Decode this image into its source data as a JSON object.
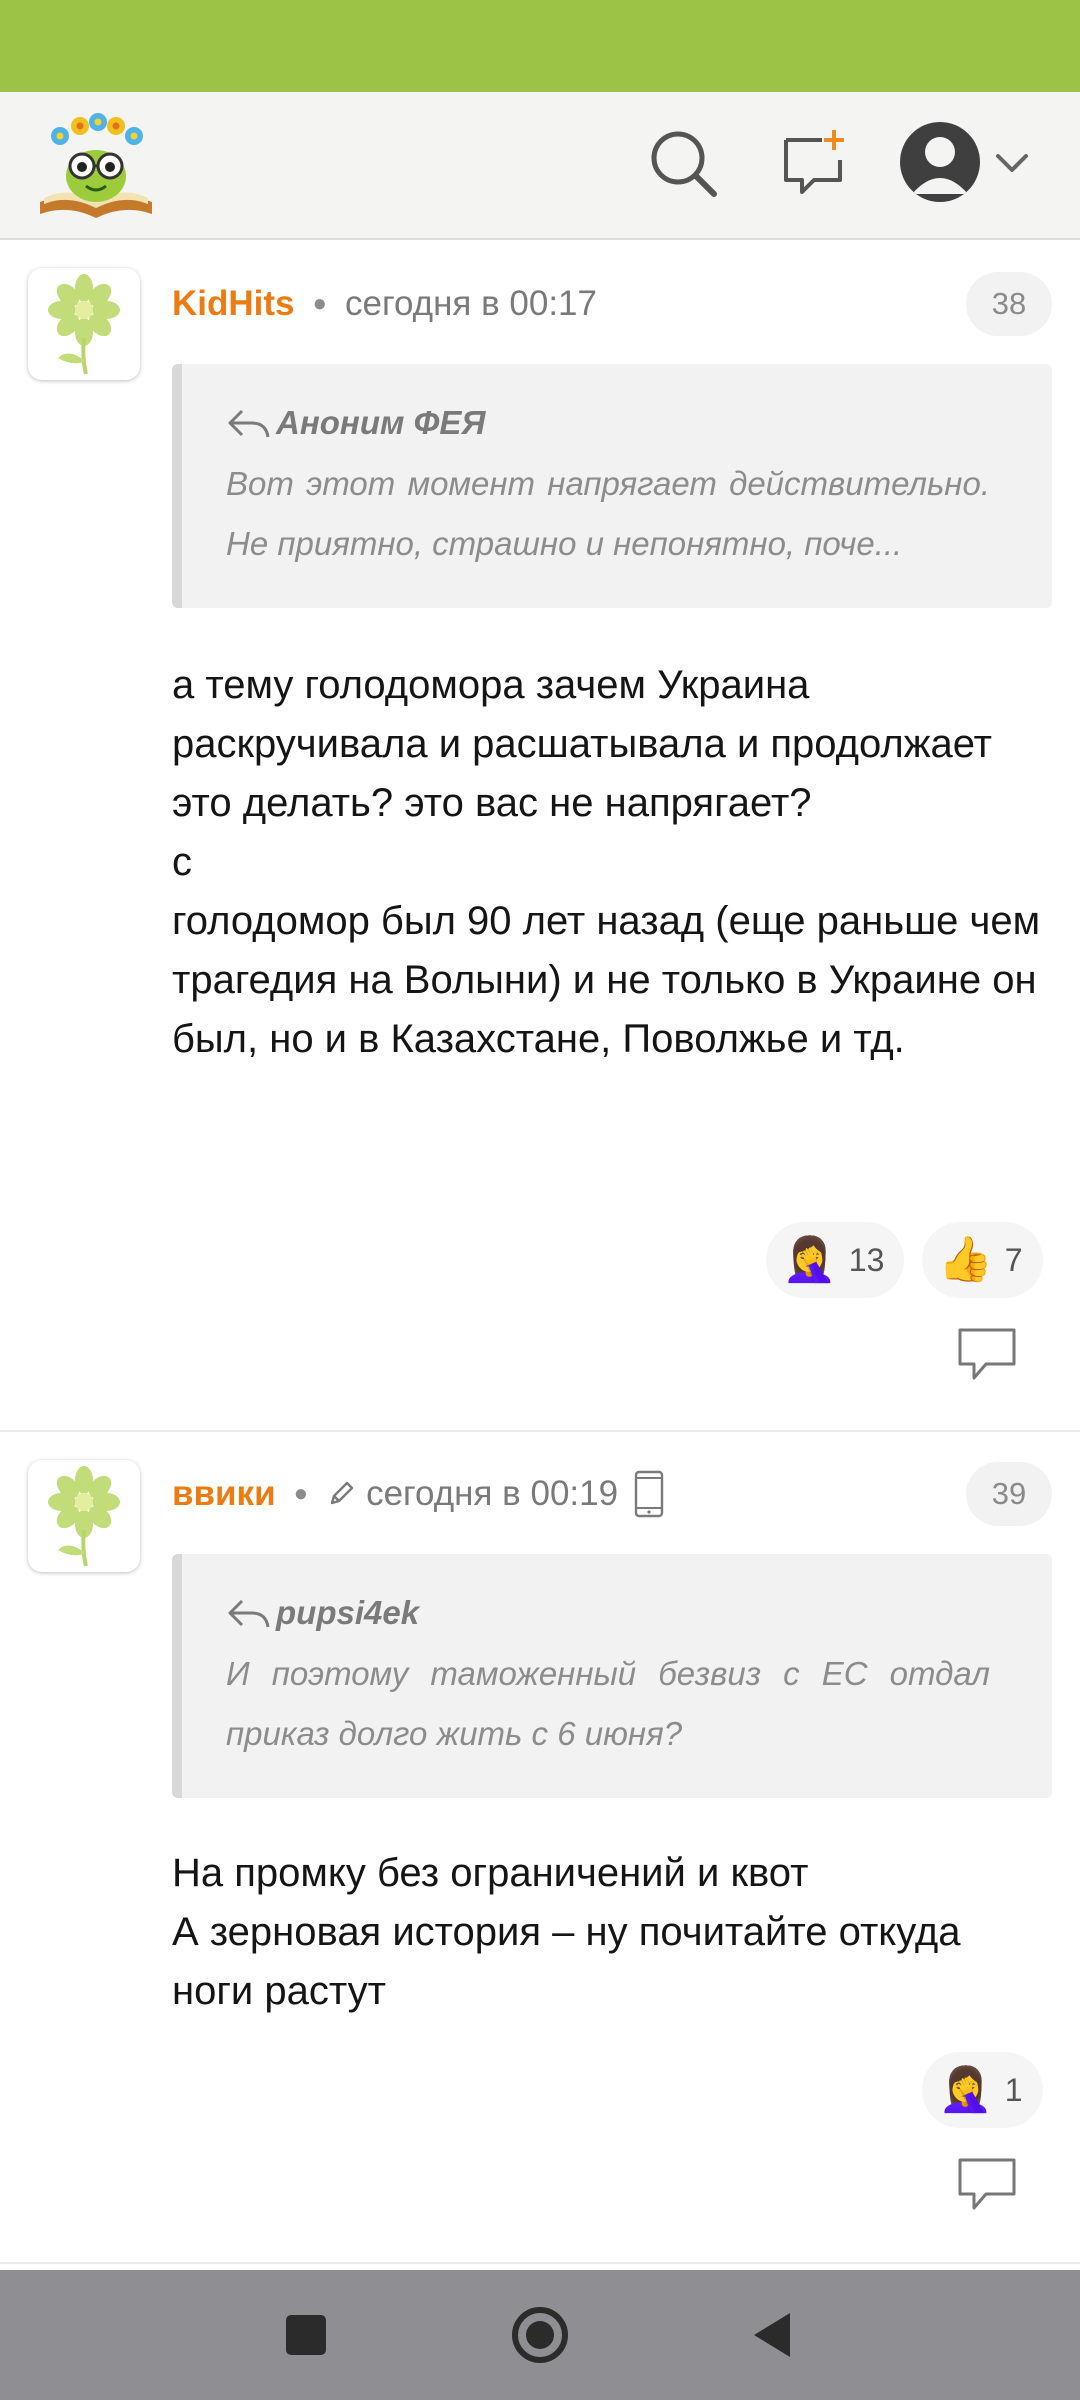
{
  "colors": {
    "status_bar": "#9cc246",
    "author": "#ec7b12",
    "navbar": "#8f8f93"
  },
  "topbar": {
    "icons": [
      "site-logo",
      "search-icon",
      "compose-message-icon",
      "user-avatar-icon",
      "chevron-down-icon"
    ]
  },
  "comments": [
    {
      "author": "KidHits",
      "time": "сегодня в 00:17",
      "number": "38",
      "edited": false,
      "mobile": false,
      "quote": {
        "author": "Аноним ФЕЯ",
        "text": "Вот этот момент напрягает действительно. Не приятно, страшно и непонятно, поче..."
      },
      "text": "а тему голодомора зачем Украина раскручивала и расшатывала и продолжает это делать? это вас не напрягает?\nс\nголодомор был 90 лет назад (еще раньше чем трагедия на Волыни) и не только в Украине он был, но и в Казахстане, Поволжье и тд.",
      "reactions": [
        {
          "emoji": "🤦‍♀️",
          "count": "13"
        },
        {
          "emoji": "👍",
          "count": "7"
        }
      ]
    },
    {
      "author": "ввики",
      "time": "сегодня в 00:19",
      "number": "39",
      "edited": true,
      "mobile": true,
      "quote": {
        "author": "pupsi4ek",
        "text": "И поэтому таможенный безвиз с ЕС отдал приказ долго жить с 6 июня?"
      },
      "text": "На промку без ограничений и квот\nА зерновая история – ну почитайте откуда ноги растут",
      "reactions": [
        {
          "emoji": "🤦‍♀️",
          "count": "1"
        }
      ]
    }
  ],
  "navbar": {
    "icons": [
      "recent-apps-icon",
      "home-icon",
      "back-icon"
    ]
  }
}
